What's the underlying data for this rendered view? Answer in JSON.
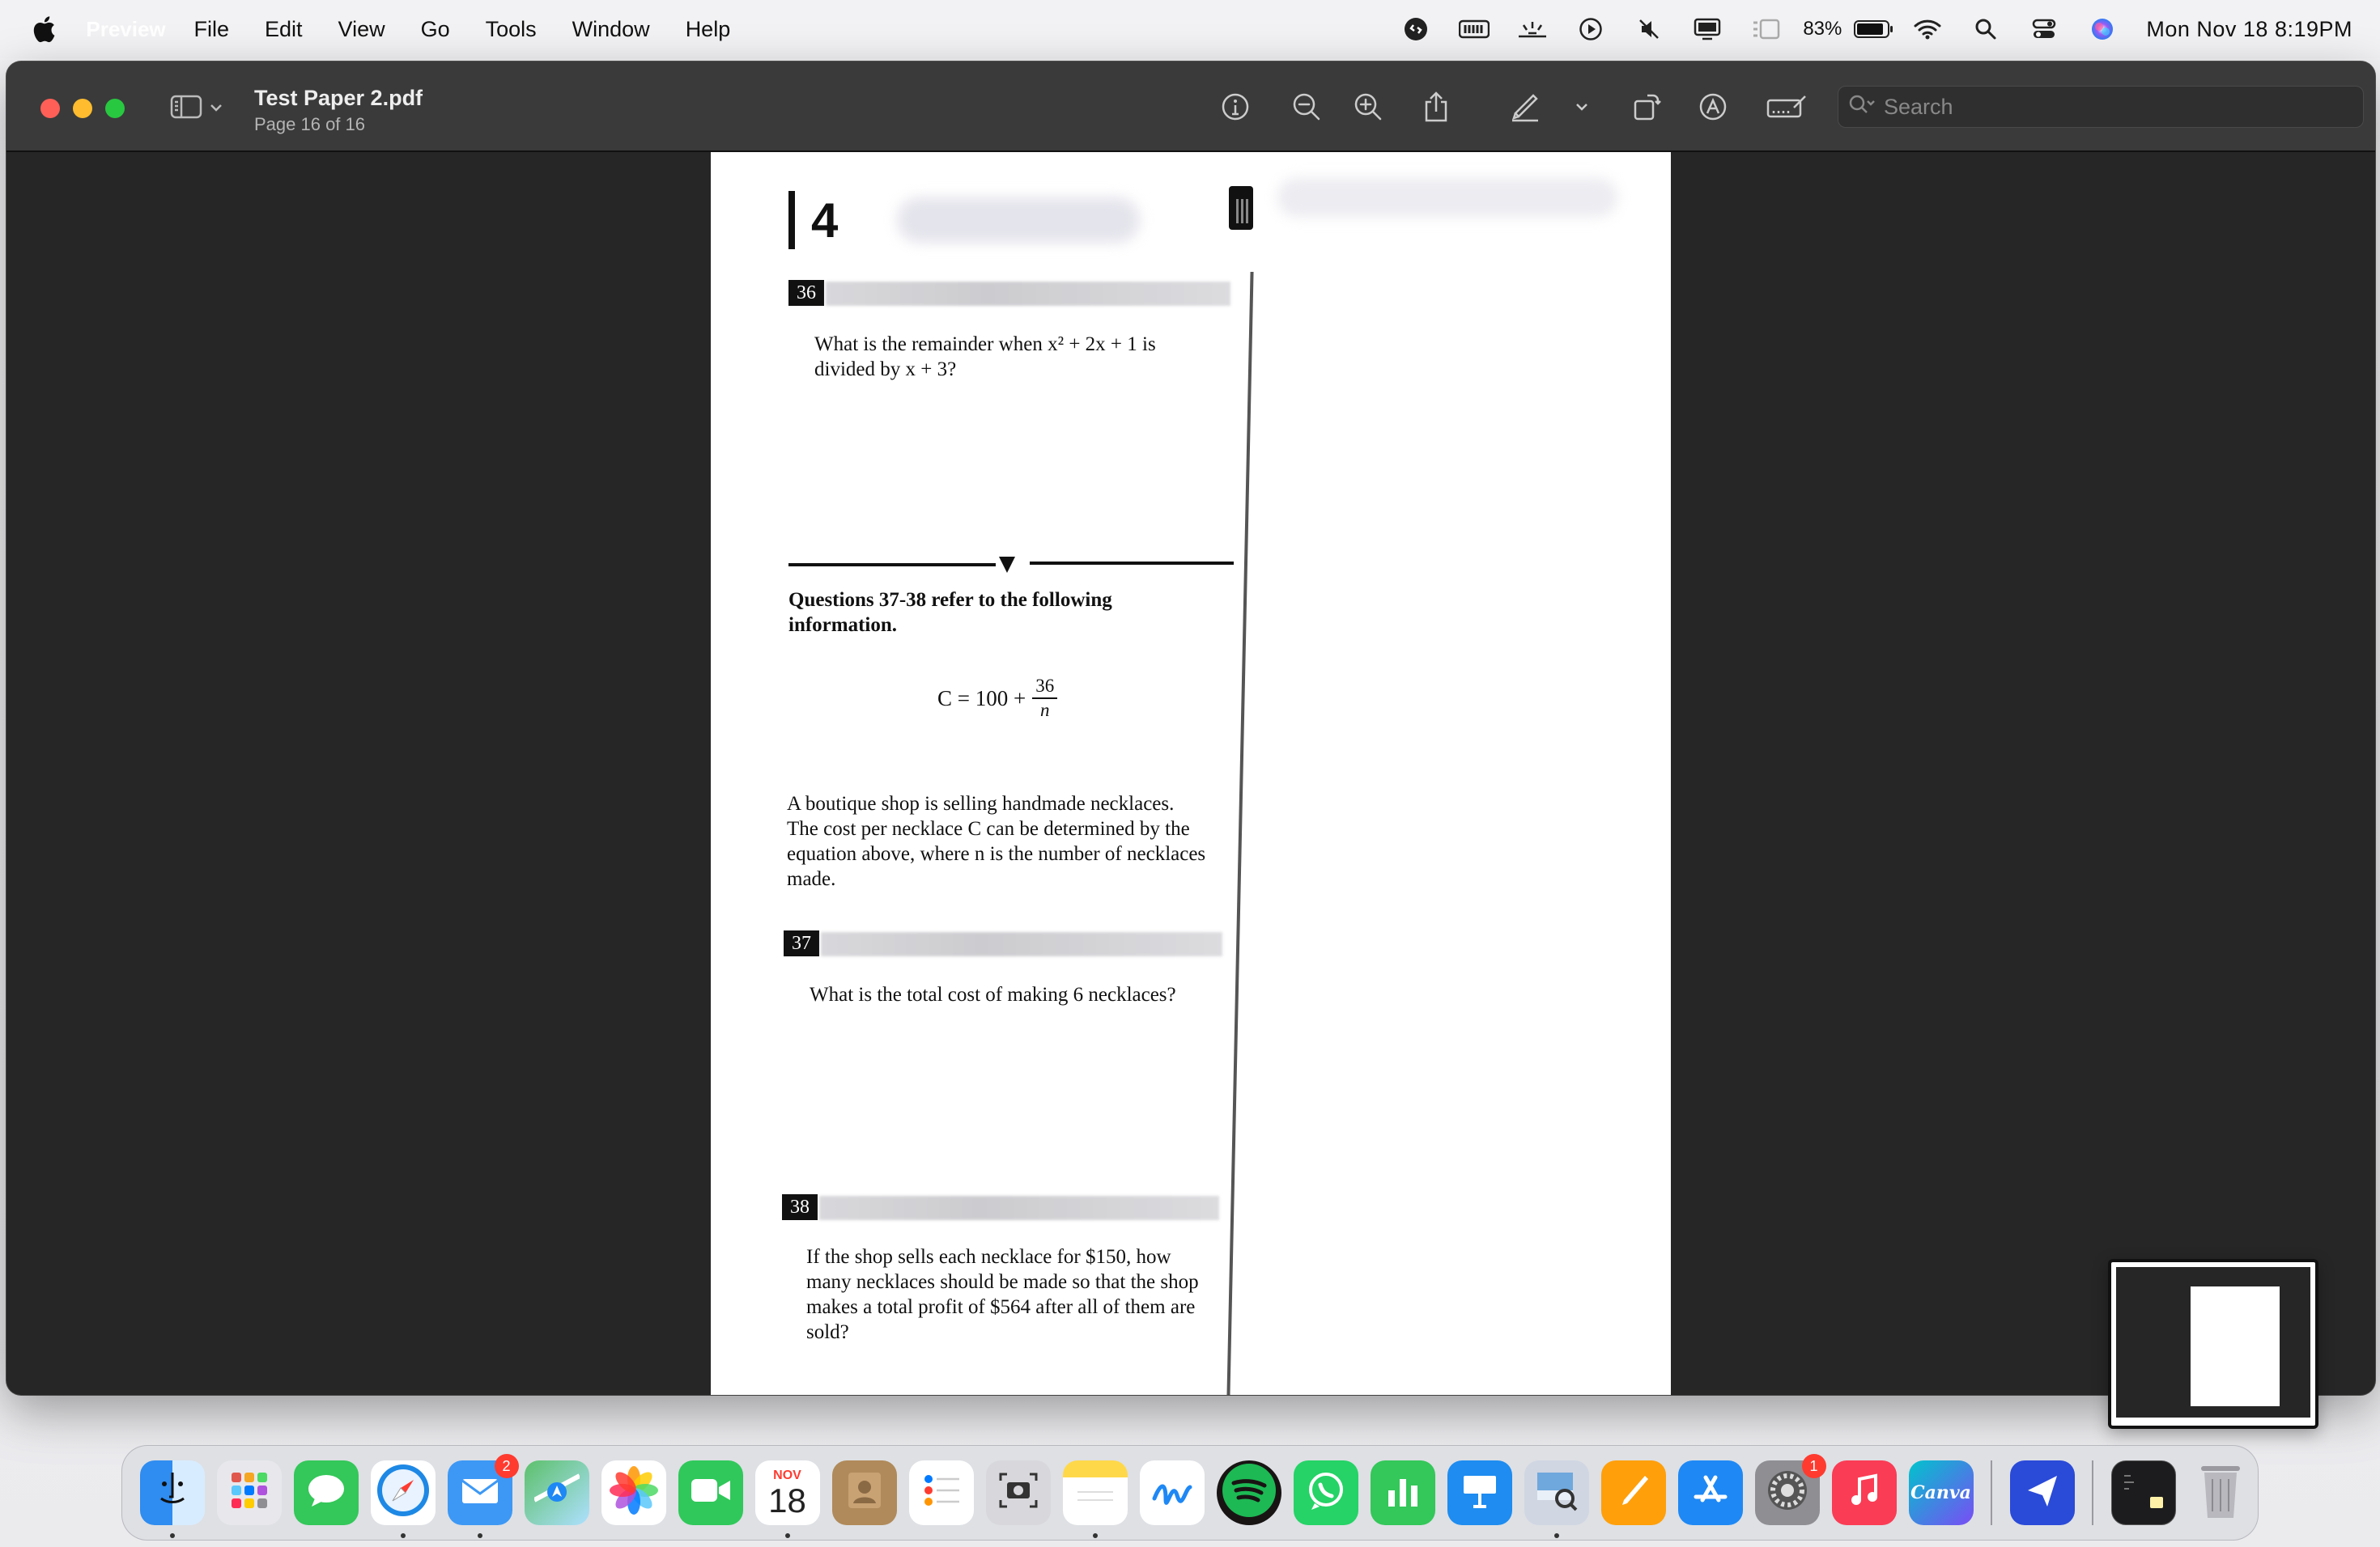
{
  "menubar": {
    "app_name": "Preview",
    "menus": [
      "File",
      "Edit",
      "View",
      "Go",
      "Tools",
      "Window",
      "Help"
    ],
    "battery_percent": "83%",
    "datetime": "Mon Nov 18  8:19PM",
    "status_icons": [
      "shazam-icon",
      "battery-meter-icon",
      "stage-light-icon",
      "play-circle-icon",
      "mute-icon",
      "display-icon",
      "stage-manager-icon",
      "battery-icon",
      "wifi-icon",
      "spotlight-icon",
      "control-center-icon",
      "siri-icon"
    ]
  },
  "window": {
    "title": "Test Paper 2.pdf",
    "subtitle": "Page 16 of 16",
    "search_placeholder": "Search",
    "toolbar_icons": [
      "info-icon",
      "zoom-out-icon",
      "zoom-in-icon",
      "share-icon",
      "markup-pen-icon",
      "markup-menu-chevron-icon",
      "rotate-icon",
      "annotate-icon",
      "form-fill-icon"
    ],
    "traffic_lights": {
      "close": "#ff5f57",
      "minimize": "#febc2e",
      "zoom": "#28c840"
    }
  },
  "page": {
    "section_number": "4",
    "q36": {
      "number": "36",
      "line1": "What is the remainder when x² + 2x + 1 is",
      "line2": "divided by x + 3?"
    },
    "info_heading": "Questions 37-38 refer to the following information.",
    "equation_lhs": "C = 100 +",
    "equation_num": "36",
    "equation_den": "n",
    "passage": [
      "A boutique shop is selling handmade necklaces.",
      "The cost per necklace C can be determined by the",
      "equation above, where n is the number of necklaces",
      "made."
    ],
    "q37": {
      "number": "37",
      "text": "What is the total cost of making 6 necklaces?"
    },
    "q38": {
      "number": "38",
      "lines": [
        "If the shop sells each necklace for $150, how",
        "many necklaces should be made so that the shop",
        "makes a total profit of $564 after all of them are",
        "sold?"
      ]
    }
  },
  "dock": {
    "apps": [
      {
        "name": "Finder",
        "color": "#2f8cf0",
        "running": true
      },
      {
        "name": "Launchpad",
        "color": "#e8e8ec",
        "running": false
      },
      {
        "name": "Messages",
        "color": "#34c759",
        "running": false
      },
      {
        "name": "Safari",
        "color": "#1e88e5",
        "running": true
      },
      {
        "name": "Mail",
        "color": "#2d8cf0",
        "running": true,
        "badge": "2"
      },
      {
        "name": "Maps",
        "color": "#5cc06a",
        "running": false
      },
      {
        "name": "Photos",
        "color": "#f5f5f5",
        "running": false
      },
      {
        "name": "FaceTime",
        "color": "#30c85a",
        "running": false
      },
      {
        "name": "Calendar",
        "color": "#ffffff",
        "running": true,
        "month": "NOV",
        "day": "18"
      },
      {
        "name": "Contacts",
        "color": "#b08a5a",
        "running": false
      },
      {
        "name": "Reminders",
        "color": "#ffffff",
        "running": false
      },
      {
        "name": "Screenshot",
        "color": "#d8d8dc",
        "running": false
      },
      {
        "name": "Notes",
        "color": "#ffd84a",
        "running": true
      },
      {
        "name": "Freeform",
        "color": "#ffffff",
        "running": false
      },
      {
        "name": "Spotify",
        "color": "#1db954",
        "running": false
      },
      {
        "name": "WhatsApp",
        "color": "#25d366",
        "running": false
      },
      {
        "name": "Numbers",
        "color": "#34c759",
        "running": false
      },
      {
        "name": "Keynote",
        "color": "#1e8cf0",
        "running": false
      },
      {
        "name": "Preview",
        "color": "#d0d6e2",
        "running": true
      },
      {
        "name": "Pages",
        "color": "#ff9f0a",
        "running": false
      },
      {
        "name": "App Store",
        "color": "#1e88f5",
        "running": false
      },
      {
        "name": "System Settings",
        "color": "#8e8e93",
        "running": false,
        "badge": "1"
      },
      {
        "name": "Music",
        "color": "#fa3c54",
        "running": false
      },
      {
        "name": "Canva",
        "color": "#7a4cf5",
        "running": false,
        "label": "Canva"
      }
    ],
    "extra": [
      {
        "name": "Spark",
        "color": "#2a4ad8"
      },
      {
        "name": "Terminal Window",
        "color": "#1c1c1e"
      },
      {
        "name": "Trash",
        "color": "#a0a0a6"
      }
    ]
  }
}
